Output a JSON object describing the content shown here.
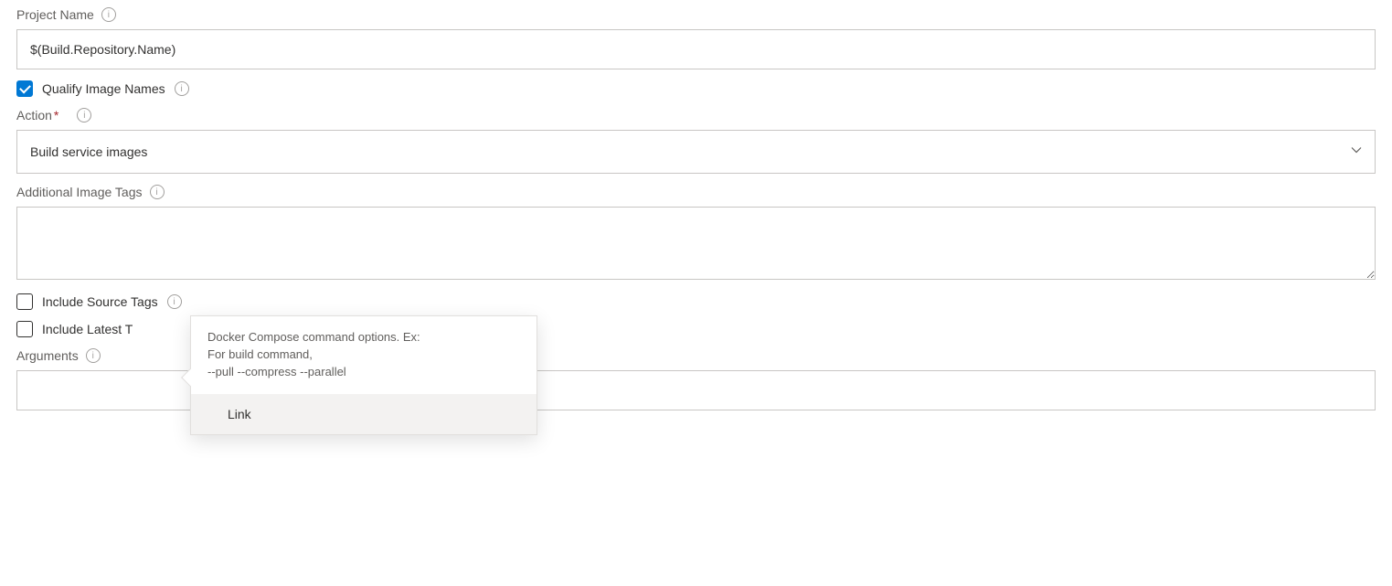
{
  "projectName": {
    "label": "Project Name",
    "value": "$(Build.Repository.Name)"
  },
  "qualifyImageNames": {
    "label": "Qualify Image Names"
  },
  "action": {
    "label": "Action",
    "required": "*",
    "value": "Build service images"
  },
  "additionalImageTags": {
    "label": "Additional Image Tags",
    "value": ""
  },
  "includeSourceTags": {
    "label": "Include Source Tags"
  },
  "includeLatestTag": {
    "label": "Include Latest T"
  },
  "arguments": {
    "label": "Arguments",
    "value": ""
  },
  "tooltip": {
    "line1": "Docker Compose command options. Ex:",
    "line2": "For build command,",
    "line3": "--pull --compress --parallel",
    "link": "Link"
  }
}
